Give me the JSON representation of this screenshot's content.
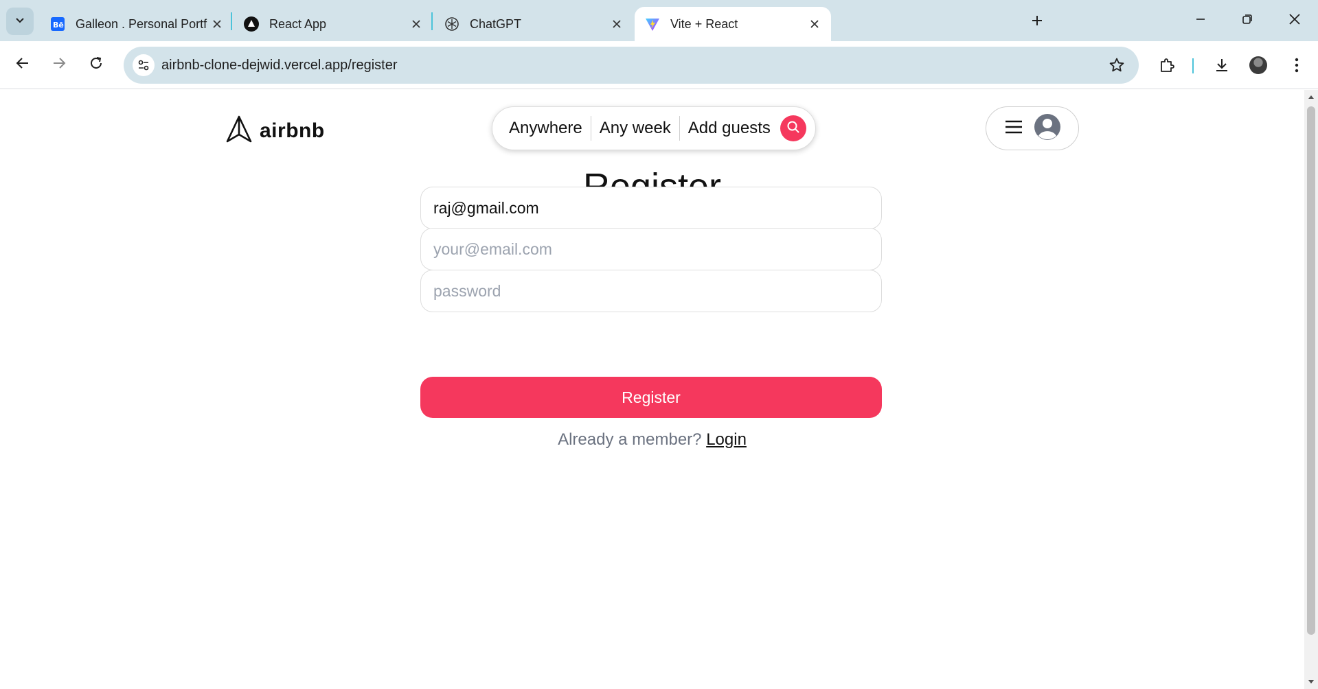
{
  "browser": {
    "tabs": [
      {
        "title": "Galleon . Personal Portfolio Wel",
        "favicon": "behance-icon"
      },
      {
        "title": "React App",
        "favicon": "react-app-icon"
      },
      {
        "title": "ChatGPT",
        "favicon": "chatgpt-icon"
      },
      {
        "title": "Vite + React",
        "favicon": "vite-icon",
        "active": true
      }
    ],
    "url": "airbnb-clone-dejwid.vercel.app/register"
  },
  "header": {
    "logo_text": "airbnb",
    "search": {
      "where": "Anywhere",
      "when": "Any week",
      "who": "Add guests"
    }
  },
  "form": {
    "title": "Register",
    "name_value": "raj@gmail.com",
    "email_placeholder": "your@email.com",
    "password_placeholder": "password",
    "submit_label": "Register",
    "footer_text": "Already a member?",
    "login_link": "Login"
  },
  "colors": {
    "brand": "#f5385d",
    "tabstrip": "#d3e3ea"
  }
}
